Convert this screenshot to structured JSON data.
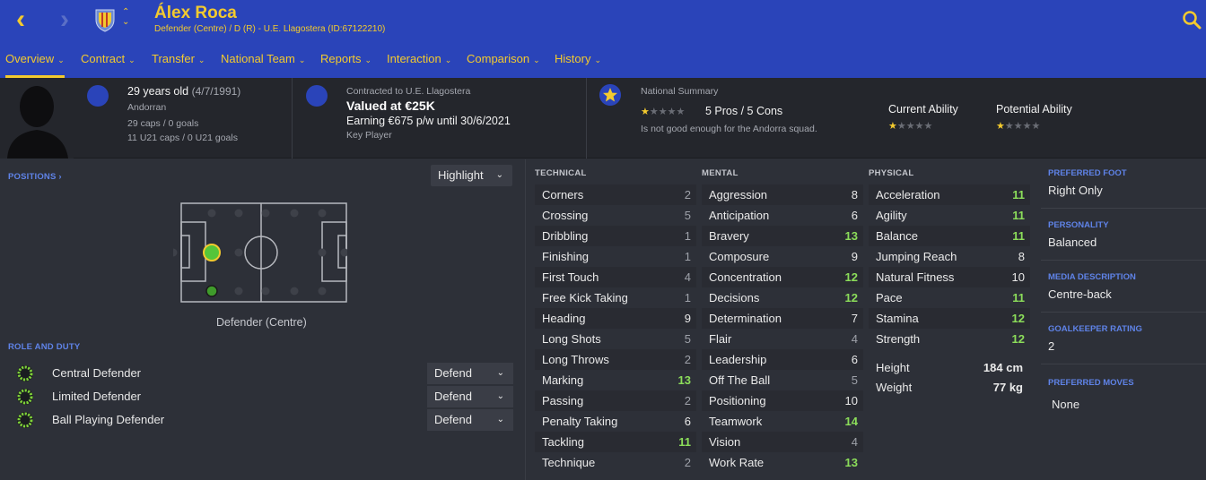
{
  "header": {
    "player_name": "Álex Roca",
    "subtitle": "Defender (Centre) / D (R) - U.E. Llagostera (ID:67122210)",
    "icons": {
      "back": "back-arrow-icon",
      "forward": "forward-arrow-icon",
      "search": "search-icon",
      "crest": "club-crest-icon"
    }
  },
  "menu": [
    {
      "label": "Overview",
      "active": true
    },
    {
      "label": "Contract"
    },
    {
      "label": "Transfer"
    },
    {
      "label": "National Team"
    },
    {
      "label": "Reports"
    },
    {
      "label": "Interaction"
    },
    {
      "label": "Comparison"
    },
    {
      "label": "History"
    }
  ],
  "info": {
    "age": "29 years old",
    "dob": "(4/7/1991)",
    "nationality": "Andorran",
    "caps": "29 caps / 0 goals",
    "u21caps": "11 U21 caps / 0 U21 goals",
    "contract_label": "Contracted to U.E. Llagostera",
    "value": "Valued at €25K",
    "wage": "Earning €675 p/w until 30/6/2021",
    "squad_status": "Key Player",
    "national_summary_label": "National Summary",
    "pros_cons": "5 Pros / 5 Cons",
    "national_note": "Is not good enough for the Andorra squad.",
    "current_ability_label": "Current Ability",
    "potential_ability_label": "Potential Ability",
    "national_stars": 0.5,
    "current_stars": 0.5,
    "potential_stars": 0.5
  },
  "positions": {
    "title": "POSITIONS",
    "highlight": "Highlight",
    "caption": "Defender (Centre)"
  },
  "role_duty": {
    "title": "ROLE AND DUTY",
    "rows": [
      {
        "role": "Central Defender",
        "duty": "Defend"
      },
      {
        "role": "Limited Defender",
        "duty": "Defend"
      },
      {
        "role": "Ball Playing Defender",
        "duty": "Defend"
      }
    ]
  },
  "technical": {
    "title": "TECHNICAL",
    "attrs": [
      {
        "name": "Corners",
        "value": "2"
      },
      {
        "name": "Crossing",
        "value": "5"
      },
      {
        "name": "Dribbling",
        "value": "1"
      },
      {
        "name": "Finishing",
        "value": "1"
      },
      {
        "name": "First Touch",
        "value": "4"
      },
      {
        "name": "Free Kick Taking",
        "value": "1"
      },
      {
        "name": "Heading",
        "value": "9"
      },
      {
        "name": "Long Shots",
        "value": "5"
      },
      {
        "name": "Long Throws",
        "value": "2"
      },
      {
        "name": "Marking",
        "value": "13"
      },
      {
        "name": "Passing",
        "value": "2"
      },
      {
        "name": "Penalty Taking",
        "value": "6"
      },
      {
        "name": "Tackling",
        "value": "11"
      },
      {
        "name": "Technique",
        "value": "2"
      }
    ]
  },
  "mental": {
    "title": "MENTAL",
    "attrs": [
      {
        "name": "Aggression",
        "value": "8"
      },
      {
        "name": "Anticipation",
        "value": "6"
      },
      {
        "name": "Bravery",
        "value": "13"
      },
      {
        "name": "Composure",
        "value": "9"
      },
      {
        "name": "Concentration",
        "value": "12"
      },
      {
        "name": "Decisions",
        "value": "12"
      },
      {
        "name": "Determination",
        "value": "7"
      },
      {
        "name": "Flair",
        "value": "4"
      },
      {
        "name": "Leadership",
        "value": "6"
      },
      {
        "name": "Off The Ball",
        "value": "5"
      },
      {
        "name": "Positioning",
        "value": "10"
      },
      {
        "name": "Teamwork",
        "value": "14"
      },
      {
        "name": "Vision",
        "value": "4"
      },
      {
        "name": "Work Rate",
        "value": "13"
      }
    ]
  },
  "physical": {
    "title": "PHYSICAL",
    "attrs": [
      {
        "name": "Acceleration",
        "value": "11"
      },
      {
        "name": "Agility",
        "value": "11"
      },
      {
        "name": "Balance",
        "value": "11"
      },
      {
        "name": "Jumping Reach",
        "value": "8"
      },
      {
        "name": "Natural Fitness",
        "value": "10"
      },
      {
        "name": "Pace",
        "value": "11"
      },
      {
        "name": "Stamina",
        "value": "12"
      },
      {
        "name": "Strength",
        "value": "12"
      }
    ],
    "height_label": "Height",
    "height": "184 cm",
    "weight_label": "Weight",
    "weight": "77 kg"
  },
  "side": {
    "preferred_foot_label": "PREFERRED FOOT",
    "preferred_foot": "Right Only",
    "personality_label": "PERSONALITY",
    "personality": "Balanced",
    "media_label": "MEDIA DESCRIPTION",
    "media": "Centre-back",
    "gk_label": "GOALKEEPER RATING",
    "gk": "2",
    "moves_label": "PREFERRED MOVES",
    "moves": "None"
  },
  "colors": {
    "accent": "#f3ca2e",
    "brand": "#2a44b9",
    "good": "#8cde5a",
    "section": "#5f83e8"
  }
}
